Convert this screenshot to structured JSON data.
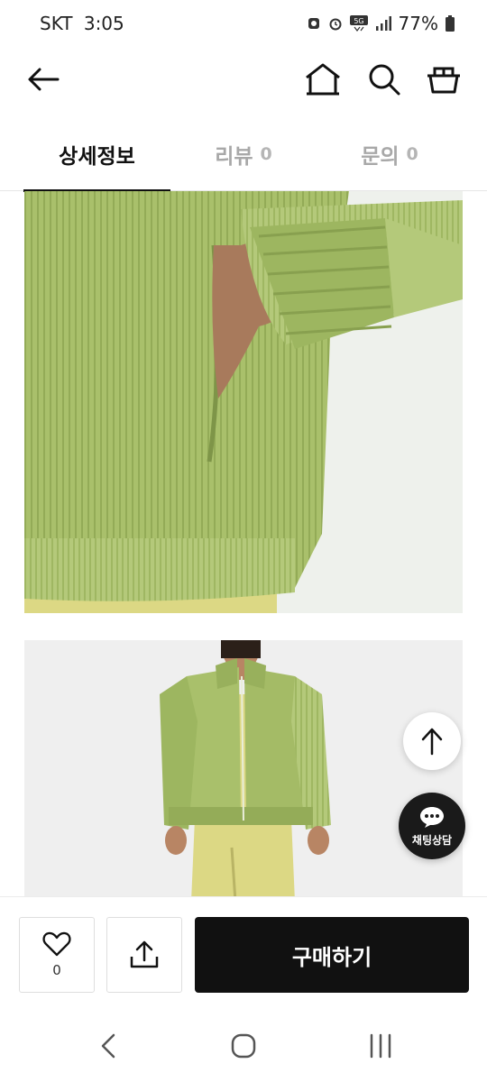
{
  "status_bar": {
    "carrier": "SKT",
    "time": "3:05",
    "network": "5G",
    "battery": "77%"
  },
  "header": {
    "back_icon": "arrow-left-icon",
    "home_icon": "home-icon",
    "search_icon": "search-icon",
    "cart_icon": "cart-icon"
  },
  "tabs": [
    {
      "label": "상세정보",
      "count": "",
      "active": true
    },
    {
      "label": "리뷰",
      "count": "0",
      "active": false
    },
    {
      "label": "문의",
      "count": "0",
      "active": false
    }
  ],
  "floating": {
    "scroll_top_icon": "arrow-up-icon",
    "chat_label": "채팅상담"
  },
  "bottom_bar": {
    "like_count": "0",
    "buy_label": "구매하기"
  },
  "colors": {
    "jacket_green": "#a8bf6a",
    "dress_yellow": "#dcd884",
    "buy_button": "#111111"
  }
}
